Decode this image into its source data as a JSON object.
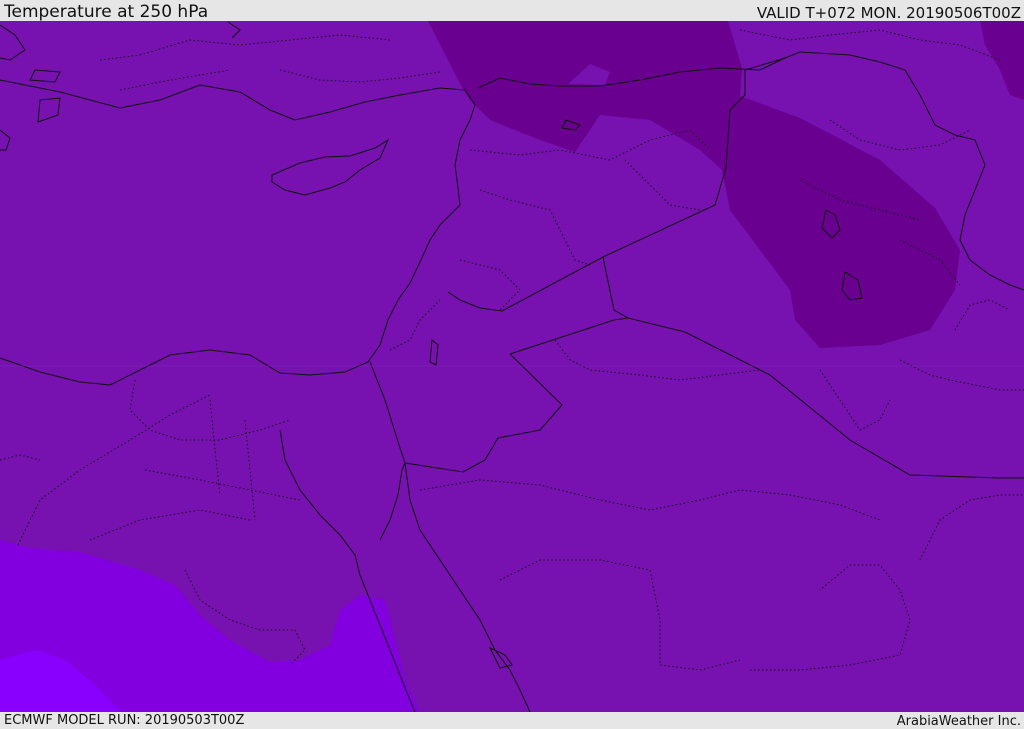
{
  "header": {
    "title": "Temperature at 250 hPa",
    "valid": "VALID T+072 MON. 20190506T00Z"
  },
  "footer": {
    "model_run": "ECMWF MODEL RUN: 20190503T00Z",
    "credit": "ArabiaWeather Inc."
  },
  "map": {
    "field": "temperature",
    "level": "250 hPa",
    "colors": {
      "base_purple": "#7712b0",
      "dark_purple": "#690090",
      "violet": "#8200e0",
      "bright_violet": "#8a00ff",
      "coastline": "#111111"
    }
  }
}
